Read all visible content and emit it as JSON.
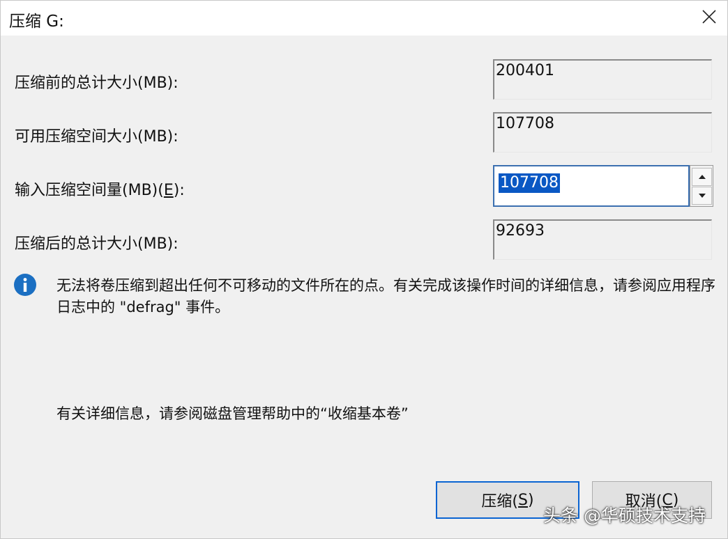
{
  "window": {
    "title": "压缩 G:"
  },
  "fields": [
    {
      "label": "压缩前的总计大小(MB):",
      "value": "200401"
    },
    {
      "label": "可用压缩空间大小(MB):",
      "value": "107708"
    },
    {
      "label_prefix": "输入压缩空间量(MB)(",
      "label_accel": "E",
      "label_suffix": "):",
      "value": "107708"
    },
    {
      "label": "压缩后的总计大小(MB):",
      "value": "92693"
    }
  ],
  "info": {
    "icon": "info-icon",
    "text": "无法将卷压缩到超出任何不可移动的文件所在的点。有关完成该操作时间的详细信息，请参阅应用程序日志中的 \"defrag\" 事件。"
  },
  "help": "有关详细信息，请参阅磁盘管理帮助中的“收缩基本卷”",
  "buttons": {
    "shrink_prefix": "压缩(",
    "shrink_accel": "S",
    "shrink_suffix": ")",
    "cancel_prefix": "取消(",
    "cancel_accel": "C",
    "cancel_suffix": ")"
  },
  "watermark": "头条 @华硕技术支持",
  "colors": {
    "selection": "#0a58c4",
    "focus_border": "#0a64d2",
    "info_icon": "#1b6fc2"
  }
}
